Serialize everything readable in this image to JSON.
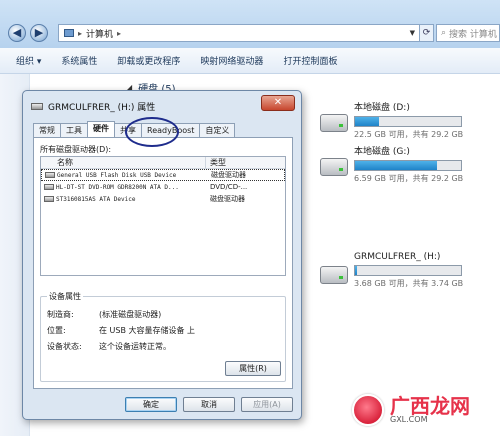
{
  "window": {
    "breadcrumb": [
      "计算机"
    ],
    "search_placeholder": "搜索 计算机",
    "toolbar": [
      "组织 ▾",
      "系统属性",
      "卸载或更改程序",
      "映射网络驱动器",
      "打开控制面板"
    ],
    "section_title": "硬盘 (5)"
  },
  "drives": [
    {
      "name": "本地磁盘 (D:)",
      "capacity": "22.5 GB 可用，共有 29.2 GB",
      "used_fraction": 0.23
    },
    {
      "name": "本地磁盘 (G:)",
      "capacity": "6.59 GB 可用，共有 29.2 GB",
      "used_fraction": 0.77
    },
    {
      "name": "GRMCULFRER_ (H:)",
      "capacity": "3.68 GB 可用，共有 3.74 GB",
      "used_fraction": 0.02
    }
  ],
  "dialog": {
    "title": "GRMCULFRER_ (H:) 属性",
    "tabs": [
      "常规",
      "工具",
      "硬件",
      "共享",
      "ReadyBoost",
      "自定义"
    ],
    "active_tab": "硬件",
    "list_caption": "所有磁盘驱动器(D):",
    "columns": [
      "名称",
      "类型"
    ],
    "devices": [
      {
        "name": "General USB Flash Disk USB Device",
        "type": "磁盘驱动器"
      },
      {
        "name": "HL-DT-ST DVD-ROM GDR8200N ATA D...",
        "type": "DVD/CD-..."
      },
      {
        "name": "ST3160815AS ATA Device",
        "type": "磁盘驱动器"
      }
    ],
    "device_props": {
      "legend": "设备属性",
      "rows": [
        {
          "key": "制造商:",
          "value": "(标准磁盘驱动器)"
        },
        {
          "key": "位置:",
          "value": "在 USB 大容量存储设备 上"
        },
        {
          "key": "设备状态:",
          "value": "这个设备运转正常。"
        }
      ],
      "properties_button": "属性(R)"
    },
    "buttons": {
      "ok": "确定",
      "cancel": "取消",
      "apply": "应用(A)"
    }
  },
  "watermark": {
    "title": "广西龙网",
    "subtitle": "GXL.COM"
  }
}
